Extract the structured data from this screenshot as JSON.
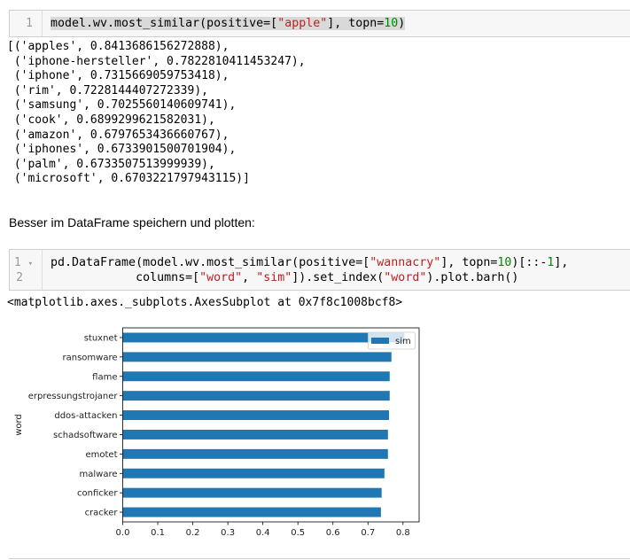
{
  "cell1": {
    "line_numbers": [
      "1"
    ],
    "code_prefix": "model.wv.most_similar(positive=[",
    "code_str": "\"apple\"",
    "code_mid": "], topn=",
    "code_num": "10",
    "code_suffix": ")"
  },
  "output1": [
    "[('apples', 0.8413686156272888),",
    " ('iphone-hersteller', 0.7822810411453247),",
    " ('iphone', 0.7315669059753418),",
    " ('rim', 0.7228144407272339),",
    " ('samsung', 0.7025560140609741),",
    " ('cook', 0.6899299621582031),",
    " ('amazon', 0.6797653436660767),",
    " ('iphones', 0.6733901500701904),",
    " ('palm', 0.6733507513999939),",
    " ('microsoft', 0.6703221797943115)]"
  ],
  "markdown": "Besser im DataFrame speichern und plotten:",
  "cell2": {
    "line_numbers": [
      "1",
      "2"
    ],
    "fold_marker": "▾",
    "l1": [
      [
        "",
        "pd.DataFrame(model.wv.most_similar(positive=["
      ],
      [
        "s",
        "\"wannacry\""
      ],
      [
        "",
        "], topn="
      ],
      [
        "n",
        "10"
      ],
      [
        "",
        ")[::-"
      ],
      [
        "n",
        "1"
      ],
      [
        "",
        "],"
      ]
    ],
    "l2": [
      [
        "",
        "            columns=["
      ],
      [
        "s",
        "\"word\""
      ],
      [
        "",
        ", "
      ],
      [
        "s",
        "\"sim\""
      ],
      [
        "",
        "]).set_index("
      ],
      [
        "s",
        "\"word\""
      ],
      [
        "",
        ").plot.barh()"
      ]
    ]
  },
  "output2": "<matplotlib.axes._subplots.AxesSubplot at 0x7f8c1008bcf8>",
  "chart_data": {
    "type": "bar",
    "orientation": "horizontal",
    "categories": [
      "stuxnet",
      "ransomware",
      "flame",
      "erpressungstrojaner",
      "ddos-attacken",
      "schadsoftware",
      "emotet",
      "malware",
      "conficker",
      "cracker"
    ],
    "series": [
      {
        "name": "sim",
        "values": [
          0.804,
          0.767,
          0.762,
          0.762,
          0.76,
          0.757,
          0.757,
          0.747,
          0.739,
          0.737
        ]
      }
    ],
    "xlabel": "",
    "ylabel": "word",
    "xlim": [
      0,
      0.846
    ],
    "xticks": [
      "0.0",
      "0.1",
      "0.2",
      "0.3",
      "0.4",
      "0.5",
      "0.6",
      "0.7",
      "0.8"
    ],
    "legend": "top-right",
    "bar_color": "#1f77b4",
    "grid": false
  }
}
